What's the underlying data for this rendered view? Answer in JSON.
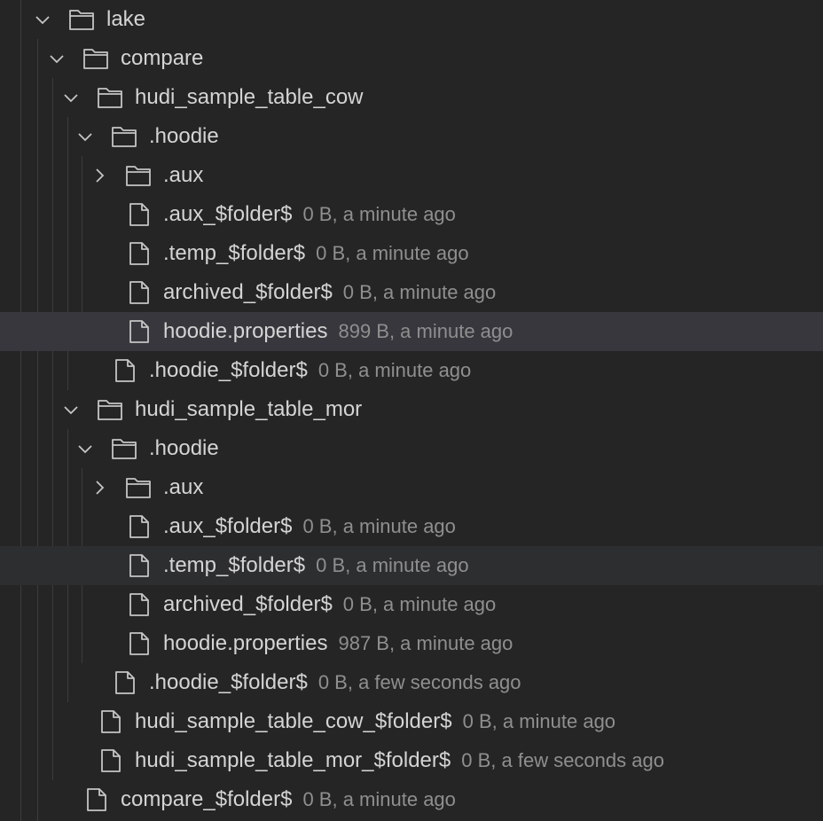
{
  "explorer": {
    "items": [
      {
        "name": "lake",
        "type": "folder",
        "state": "expanded"
      },
      {
        "name": "compare",
        "type": "folder",
        "state": "expanded"
      },
      {
        "name": "hudi_sample_table_cow",
        "type": "folder",
        "state": "expanded"
      },
      {
        "name": ".hoodie",
        "type": "folder",
        "state": "expanded"
      },
      {
        "name": ".aux",
        "type": "folder",
        "state": "collapsed"
      },
      {
        "name": ".aux_$folder$",
        "type": "file",
        "meta": "0 B, a minute ago"
      },
      {
        "name": ".temp_$folder$",
        "type": "file",
        "meta": "0 B, a minute ago"
      },
      {
        "name": "archived_$folder$",
        "type": "file",
        "meta": "0 B, a minute ago"
      },
      {
        "name": "hoodie.properties",
        "type": "file",
        "meta": "899 B, a minute ago"
      },
      {
        "name": ".hoodie_$folder$",
        "type": "file",
        "meta": "0 B, a minute ago"
      },
      {
        "name": "hudi_sample_table_mor",
        "type": "folder",
        "state": "expanded"
      },
      {
        "name": ".hoodie",
        "type": "folder",
        "state": "expanded"
      },
      {
        "name": ".aux",
        "type": "folder",
        "state": "collapsed"
      },
      {
        "name": ".aux_$folder$",
        "type": "file",
        "meta": "0 B, a minute ago"
      },
      {
        "name": ".temp_$folder$",
        "type": "file",
        "meta": "0 B, a minute ago"
      },
      {
        "name": "archived_$folder$",
        "type": "file",
        "meta": "0 B, a minute ago"
      },
      {
        "name": "hoodie.properties",
        "type": "file",
        "meta": "987 B, a minute ago"
      },
      {
        "name": ".hoodie_$folder$",
        "type": "file",
        "meta": "0 B, a few seconds ago"
      },
      {
        "name": "hudi_sample_table_cow_$folder$",
        "type": "file",
        "meta": "0 B, a minute ago"
      },
      {
        "name": "hudi_sample_table_mor_$folder$",
        "type": "file",
        "meta": "0 B, a few seconds ago"
      },
      {
        "name": "compare_$folder$",
        "type": "file",
        "meta": "0 B, a minute ago"
      }
    ]
  },
  "colors": {
    "background": "#252526",
    "text": "#d4d4d4",
    "meta_text": "#8f8f8f",
    "selected_row": "#37373d",
    "hover_row": "#2d2e2f",
    "guide": "#3c3c3c"
  }
}
